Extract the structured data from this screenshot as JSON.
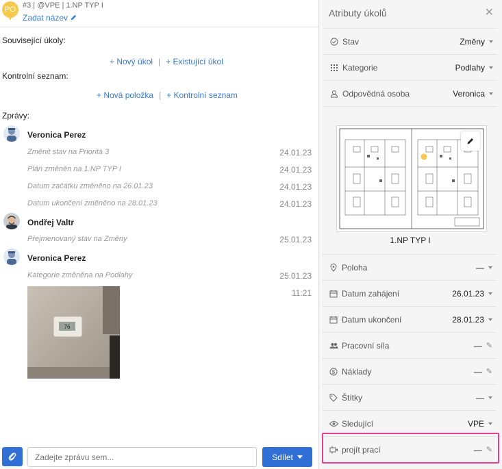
{
  "task": {
    "initials": "PO",
    "meta": "#3 | @VPE | 1.NP TYP I",
    "set_name": "Zadat název"
  },
  "related": {
    "label": "Související úkoly:",
    "new_label": "+ Nový úkol",
    "existing_label": "+ Existující úkol"
  },
  "checklist": {
    "label": "Kontrolní seznam:",
    "new_label": "+ Nová položka",
    "existing_label": "+ Kontrolní seznam"
  },
  "messages": {
    "label": "Zprávy:",
    "groups": [
      {
        "user": "Veronica Perez",
        "entries": [
          {
            "text": "Změnit stav na Priorita 3",
            "date": "24.01.23"
          },
          {
            "text": "Plán změněn na 1.NP TYP I",
            "date": "24.01.23"
          },
          {
            "text": "Datum začátku změněno na 26.01.23",
            "date": "24.01.23"
          },
          {
            "text": "Datum ukončení změněno na 28.01.23",
            "date": "24.01.23"
          }
        ]
      },
      {
        "user": "Ondřej Valtr",
        "entries": [
          {
            "text": "Přejmenovaný stav na Změny",
            "date": "25.01.23"
          }
        ]
      },
      {
        "user": "Veronica Perez",
        "entries": [
          {
            "text": "Kategorie změněna na Podlahy",
            "date": "25.01.23"
          }
        ],
        "photo_time": "11:21",
        "thermostat_reading": "76"
      }
    ]
  },
  "composer": {
    "placeholder": "Zadejte zprávu sem...",
    "share_label": "Sdílet"
  },
  "panel": {
    "title": "Atributy úkolů",
    "attrs": [
      {
        "label": "Stav",
        "value": "Změny",
        "icon": "check-circle-icon"
      },
      {
        "label": "Kategorie",
        "value": "Podlahy",
        "icon": "grid-icon"
      },
      {
        "label": "Odpovědná osoba",
        "value": "Veronica",
        "icon": "person-icon"
      }
    ],
    "plan_name": "1.NP TYP I",
    "attrs2": [
      {
        "label": "Poloha",
        "value": "—",
        "icon": "location-pin-icon"
      },
      {
        "label": "Datum zahájení",
        "value": "26.01.23",
        "icon": "calendar-icon"
      },
      {
        "label": "Datum ukončení",
        "value": "28.01.23",
        "icon": "calendar-icon"
      },
      {
        "label": "Pracovní síla",
        "value": "—",
        "icon": "people-icon"
      },
      {
        "label": "Náklady",
        "value": "—",
        "icon": "dollar-icon"
      },
      {
        "label": "Štítky",
        "value": "—",
        "icon": "tag-icon"
      },
      {
        "label": "Sledující",
        "value": "VPE",
        "icon": "eye-icon"
      },
      {
        "label": "projít prací",
        "value": "—",
        "icon": "custom-field-icon"
      }
    ]
  },
  "colors": {
    "accent": "#3a7bd5",
    "button": "#2f6fd6",
    "pin": "#f6c94c",
    "highlight": "#e83e8c"
  }
}
